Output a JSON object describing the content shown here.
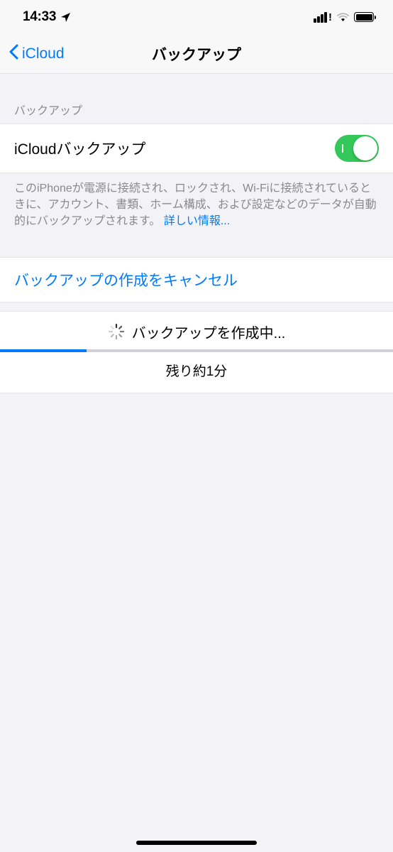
{
  "statusBar": {
    "time": "14:33"
  },
  "nav": {
    "backLabel": "iCloud",
    "title": "バックアップ"
  },
  "backup": {
    "sectionHeader": "バックアップ",
    "toggleLabel": "iCloudバックアップ",
    "toggleOn": true,
    "footerText": "このiPhoneが電源に接続され、ロックされ、Wi-Fiに接続されているときに、アカウント、書類、ホーム構成、および設定などのデータが自動的にバックアップされます。",
    "footerLink": "詳しい情報..."
  },
  "cancel": {
    "label": "バックアップの作成をキャンセル"
  },
  "progress": {
    "statusText": "バックアップを作成中...",
    "percent": 22,
    "remainingText": "残り約1分"
  }
}
